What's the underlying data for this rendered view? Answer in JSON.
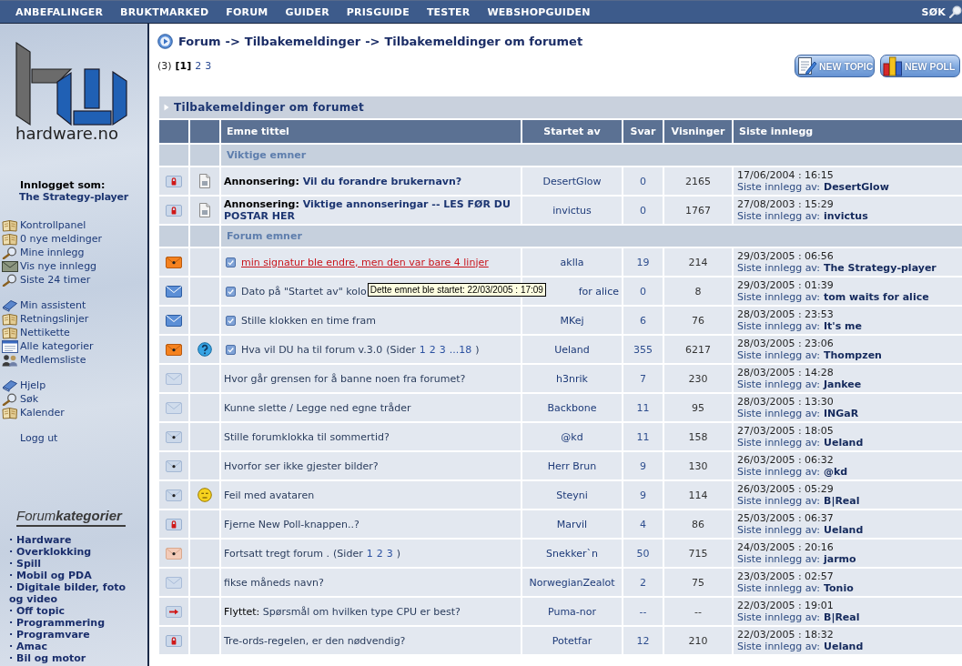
{
  "nav": {
    "items": [
      "ANBEFALINGER",
      "BRUKTMARKED",
      "FORUM",
      "GUIDER",
      "PRISGUIDE",
      "TESTER",
      "WEBSHOPGUIDEN"
    ],
    "search": "SØK"
  },
  "sidebar": {
    "logo_text": "hardware.no",
    "login_label": "Innlogget som:",
    "user": "The Strategy-player",
    "menu_groups": [
      [
        {
          "label": "Kontrollpanel",
          "kind": "book"
        },
        {
          "label": "0 nye meldinger",
          "kind": "book"
        },
        {
          "label": "Mine innlegg",
          "kind": "magnifier"
        },
        {
          "label": "Vis nye innlegg",
          "kind": "envelope"
        },
        {
          "label": "Siste 24 timer",
          "kind": "magnifier"
        }
      ],
      [
        {
          "label": "Min assistent",
          "kind": "blue-book"
        },
        {
          "label": "Retningslinjer",
          "kind": "book"
        },
        {
          "label": "Nettikette",
          "kind": "book"
        },
        {
          "label": "Alle kategorier",
          "kind": "window"
        },
        {
          "label": "Medlemsliste",
          "kind": "people"
        }
      ],
      [
        {
          "label": "Hjelp",
          "kind": "blue-book"
        },
        {
          "label": "Søk",
          "kind": "magnifier"
        },
        {
          "label": "Kalender",
          "kind": "book"
        }
      ]
    ],
    "logout": "Logg ut",
    "categories_title": "Forum**kategorier**",
    "categories": [
      "· Hardware",
      "· Overklokking",
      "· Spill",
      "· Mobil og PDA",
      "· Digitale bilder, foto og video",
      "· Off topic",
      "· Programmering",
      "· Programvare",
      "· Amac",
      "· Bil og motor"
    ]
  },
  "breadcrumb": {
    "links": [
      "Forum",
      "Tilbakemeldinger",
      "Tilbakemeldinger om forumet"
    ],
    "separators": [
      "->",
      "->"
    ]
  },
  "pagination": {
    "count": "(3)",
    "pages": [
      {
        "label": "[1]",
        "selected": true
      },
      {
        "label": "2",
        "selected": false
      },
      {
        "label": "3",
        "selected": false
      }
    ]
  },
  "buttons": [
    {
      "label": "NEW TOPIC",
      "kind": "topic"
    },
    {
      "label": "NEW POLL",
      "kind": "poll"
    }
  ],
  "forum": {
    "title": "Tilbakemeldinger om forumet",
    "columns": [
      "Emne tittel",
      "Startet av",
      "Svar",
      "Visninger",
      "Siste innlegg"
    ],
    "sections": [
      {
        "label": "Viktige emner",
        "kind": "announcements",
        "rows": [
          {
            "kind": "locked",
            "topic_icon": {
              "kind": "document"
            },
            "new_posts": false,
            "hovered": false,
            "prefix": "Annonsering:",
            "title": "Vil du forandre brukernavn?",
            "starter": "DesertGlow",
            "replies": "0",
            "views": "2165",
            "last_date": "17/06/2004 : 16:15",
            "last_label": "Siste innlegg av:",
            "last_author": "DesertGlow"
          },
          {
            "kind": "locked",
            "topic_icon": {
              "kind": "document"
            },
            "new_posts": false,
            "hovered": false,
            "prefix": "Annonsering:",
            "title": "Viktige annonseringar -- LES FØR DU POSTAR HER",
            "starter": "invictus",
            "replies": "0",
            "views": "1767",
            "last_date": "27/08/2003 : 15:29",
            "last_label": "Siste innlegg av:",
            "last_author": "invictus"
          }
        ]
      },
      {
        "label": "Forum emner",
        "kind": "topics",
        "rows": [
          {
            "kind": "new-hot",
            "new_posts": true,
            "hovered": true,
            "title": "min signatur ble endre, men den var bare 4 linjer",
            "starter": "aklla",
            "replies": "19",
            "views": "214",
            "last_date": "29/03/2005 : 06:56",
            "last_label": "Siste innlegg av:",
            "last_author": "The Strategy-player"
          },
          {
            "kind": "new",
            "new_posts": true,
            "hovered": false,
            "title": "Dato på \"Startet av\" kolo",
            "tooltip": "Dette emnet ble startet: 22/03/2005 : 17:09",
            "starter": "for alice",
            "replies": "0",
            "views": "8",
            "last_date": "29/03/2005 : 01:39",
            "last_label": "Siste innlegg av:",
            "last_author": "tom waits for alice"
          },
          {
            "kind": "new",
            "new_posts": true,
            "hovered": false,
            "title": "Stille klokken en time fram",
            "starter": "MKej",
            "replies": "6",
            "views": "76",
            "last_date": "28/03/2005 : 23:53",
            "last_label": "Siste innlegg av:",
            "last_author": "It's me"
          },
          {
            "kind": "new-hot",
            "topic_icon": {
              "kind": "question"
            },
            "new_posts": true,
            "hovered": false,
            "title": "Hva vil DU ha til forum v.3.0",
            "pages": {
              "prefix": "(Sider",
              "links": [
                "1",
                "2",
                "3",
                "...18"
              ],
              "suffix": ")"
            },
            "starter": "Ueland",
            "replies": "355",
            "views": "6217",
            "last_date": "28/03/2005 : 23:06",
            "last_label": "Siste innlegg av:",
            "last_author": "Thompzen"
          },
          {
            "kind": "read",
            "new_posts": false,
            "hovered": false,
            "title": "Hvor går grensen for å banne noen fra forumet?",
            "starter": "h3nrik",
            "replies": "7",
            "views": "230",
            "last_date": "28/03/2005 : 14:28",
            "last_label": "Siste innlegg av:",
            "last_author": "Jankee"
          },
          {
            "kind": "read",
            "new_posts": false,
            "hovered": false,
            "title": "Kunne slette / Legge ned egne tråder",
            "starter": "Backbone",
            "replies": "11",
            "views": "95",
            "last_date": "28/03/2005 : 13:30",
            "last_label": "Siste innlegg av:",
            "last_author": "INGaR"
          },
          {
            "kind": "read-hot",
            "new_posts": false,
            "hovered": false,
            "title": "Stille forumklokka til sommertid?",
            "starter": "@kd",
            "replies": "11",
            "views": "158",
            "last_date": "27/03/2005 : 18:05",
            "last_label": "Siste innlegg av:",
            "last_author": "Ueland"
          },
          {
            "kind": "read-hot",
            "new_posts": false,
            "hovered": false,
            "title": "Hvorfor ser ikke gjester bilder?",
            "starter": "Herr Brun",
            "replies": "9",
            "views": "130",
            "last_date": "26/03/2005 : 06:32",
            "last_label": "Siste innlegg av:",
            "last_author": "@kd"
          },
          {
            "kind": "read-hot",
            "topic_icon": {
              "kind": "smiley"
            },
            "new_posts": false,
            "hovered": false,
            "title": "Feil med avataren",
            "starter": "Steyni",
            "replies": "9",
            "views": "114",
            "last_date": "26/03/2005 : 05:29",
            "last_label": "Siste innlegg av:",
            "last_author": "B|Real"
          },
          {
            "kind": "locked",
            "new_posts": false,
            "hovered": false,
            "title": "Fjerne New Poll-knappen..?",
            "starter": "Marvil",
            "replies": "4",
            "views": "86",
            "last_date": "25/03/2005 : 06:37",
            "last_label": "Siste innlegg av:",
            "last_author": "Ueland"
          },
          {
            "kind": "read-hot-posted",
            "new_posts": false,
            "hovered": false,
            "title": "Fortsatt tregt forum .",
            "pages": {
              "prefix": "(Sider",
              "links": [
                "1",
                "2",
                "3"
              ],
              "suffix": ")"
            },
            "starter": "Snekker`n",
            "replies": "50",
            "views": "715",
            "last_date": "24/03/2005 : 20:16",
            "last_label": "Siste innlegg av:",
            "last_author": "jarmo"
          },
          {
            "kind": "read",
            "new_posts": false,
            "hovered": false,
            "title": "fikse måneds navn?",
            "starter": "NorwegianZealot",
            "replies": "2",
            "views": "75",
            "last_date": "23/03/2005 : 02:57",
            "last_label": "Siste innlegg av:",
            "last_author": "Tonio"
          },
          {
            "kind": "moved",
            "new_posts": false,
            "hovered": false,
            "prefix": "Flyttet:",
            "title": "Spørsmål om hvilken type CPU er best?",
            "starter": "Puma-nor",
            "replies": "--",
            "views": "--",
            "last_date": "22/03/2005 : 19:01",
            "last_label": "Siste innlegg av:",
            "last_author": "B|Real"
          },
          {
            "kind": "locked",
            "new_posts": false,
            "hovered": false,
            "title": "Tre-ords-regelen, er den nødvendig?",
            "starter": "Potetfar",
            "replies": "12",
            "views": "210",
            "last_date": "22/03/2005 : 18:32",
            "last_label": "Siste innlegg av:",
            "last_author": "Ueland"
          }
        ]
      }
    ]
  }
}
